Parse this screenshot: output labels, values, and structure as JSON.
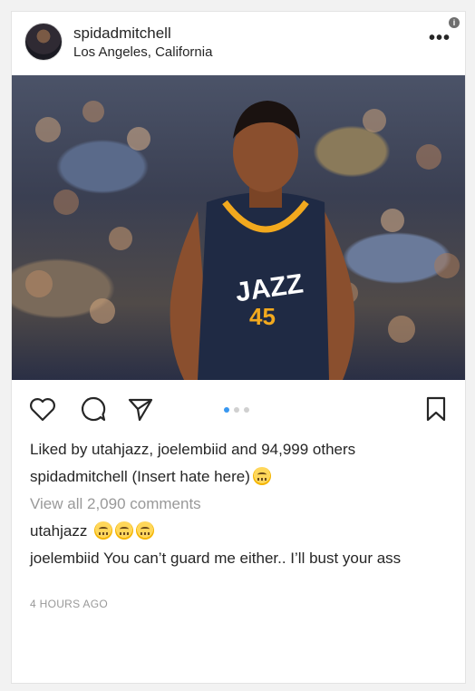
{
  "post": {
    "username": "spidadmitchell",
    "location": "Los Angeles, California",
    "more_icon": "•••",
    "info_icon": "i",
    "image_description_icon": "photo",
    "carousel": {
      "count": 3,
      "active_index": 0
    }
  },
  "likes": {
    "prefix": "Liked by ",
    "user1": "utahjazz",
    "sep": ", ",
    "user2": "joelembiid",
    "middle": " and ",
    "count": "94,999 others"
  },
  "caption": {
    "username": "spidadmitchell",
    "text": " (Insert hate here)"
  },
  "view_all_comments": "View all 2,090 comments",
  "comments": [
    {
      "username": "utahjazz",
      "text": " "
    },
    {
      "username": "joelembiid",
      "text": " You can’t guard me either.. I’ll bust your ass"
    }
  ],
  "timestamp": "4 HOURS AGO",
  "colors": {
    "accent": "#3897f0",
    "muted": "#999999",
    "text": "#262626"
  }
}
